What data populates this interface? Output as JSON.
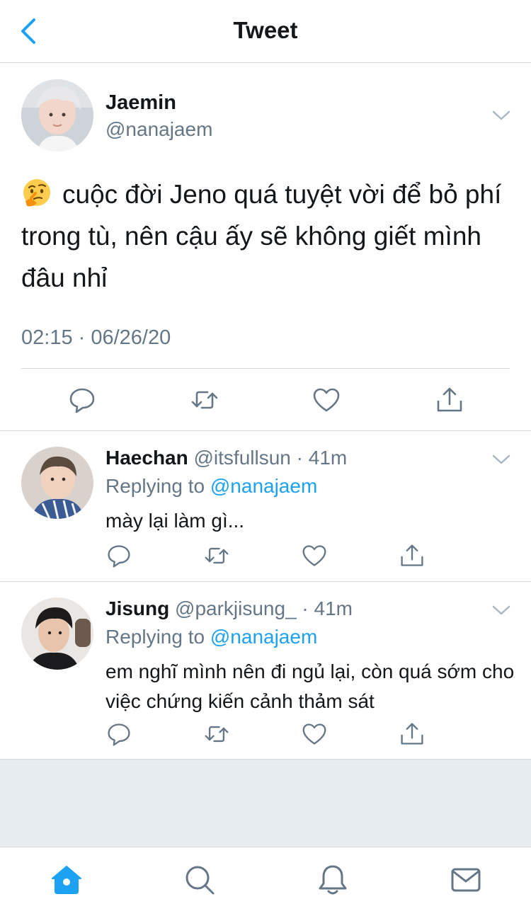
{
  "header": {
    "title": "Tweet"
  },
  "main_tweet": {
    "name": "Jaemin",
    "handle": "@nanajaem",
    "text": "cuộc đời Jeno quá tuyệt vời để bỏ phí trong tù, nên cậu ấy sẽ không giết mình đâu nhỉ",
    "emoji": "thinking-face",
    "timestamp": "02:15 · 06/26/20"
  },
  "replies": [
    {
      "name": "Haechan",
      "handle": "@itsfullsun",
      "dot": "·",
      "time": "41m",
      "replying_prefix": "Replying to",
      "replying_to": "@nanajaem",
      "text": "mày lại làm gì..."
    },
    {
      "name": "Jisung",
      "handle": "@parkjisung_",
      "dot": "·",
      "time": "41m",
      "replying_prefix": "Replying to",
      "replying_to": "@nanajaem",
      "text": "em nghĩ mình nên đi ngủ lại, còn quá sớm cho việc chứng kiến cảnh thảm sát"
    }
  ],
  "tabbar": {
    "items": [
      "home-icon",
      "search-icon",
      "bell-icon",
      "mail-icon"
    ],
    "active": "home-icon"
  },
  "colors": {
    "accent": "#1da1f2",
    "icon_gray": "#657786",
    "text": "#14171a",
    "divider": "#d4d9de",
    "background_gray": "#e6ecf0"
  }
}
